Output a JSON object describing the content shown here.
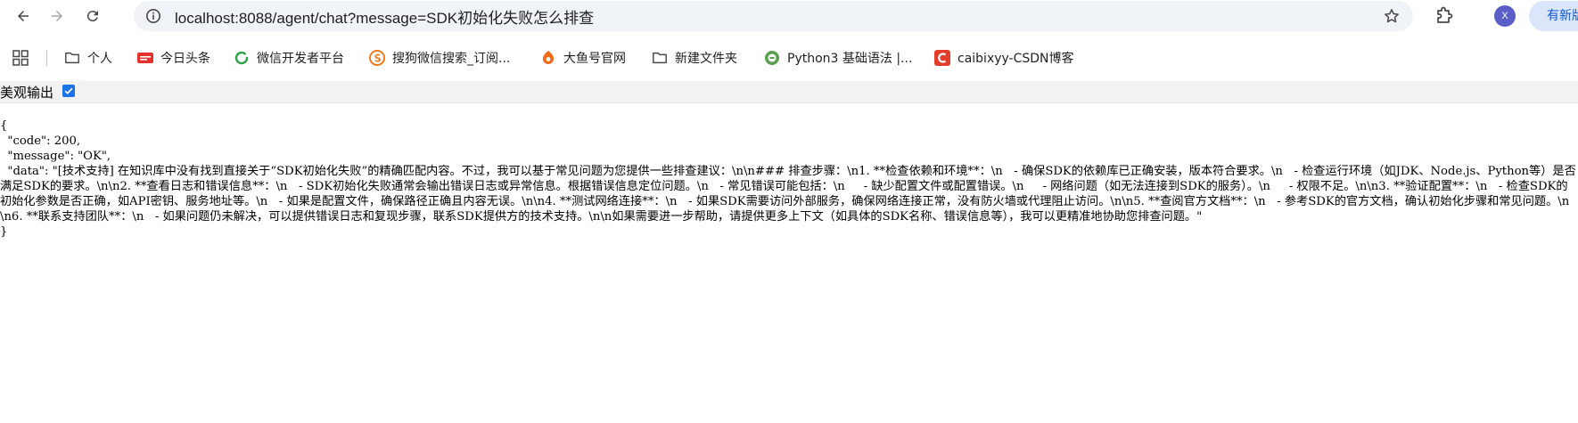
{
  "toolbar": {
    "url": "localhost:8088/agent/chat?message=SDK初始化失败怎么排查",
    "avatar_letter": "X",
    "update_label": "有新版"
  },
  "bookmarks": [
    {
      "label": "个人",
      "icon": "folder-icon"
    },
    {
      "label": "今日头条",
      "icon": "toutiao-icon"
    },
    {
      "label": "微信开发者平台",
      "icon": "wechat-dev-icon"
    },
    {
      "label": "搜狗微信搜索_订阅...",
      "icon": "sogou-icon"
    },
    {
      "label": "大鱼号官网",
      "icon": "dayu-icon"
    },
    {
      "label": "新建文件夹",
      "icon": "folder-icon"
    },
    {
      "label": "Python3 基础语法 |...",
      "icon": "python-icon"
    },
    {
      "label": "caibixyy-CSDN博客",
      "icon": "csdn-icon"
    }
  ],
  "viewer": {
    "pretty_label": "美观输出",
    "pretty_checked": true
  },
  "json": {
    "open": "{",
    "code_line": "  \"code\": 200,",
    "message_line": "  \"message\": \"OK\",",
    "data_line": "  \"data\": \"[技术支持] 在知识库中没有找到直接关于“SDK初始化失败”的精确匹配内容。不过，我可以基于常见问题为您提供一些排查建议：\\n\\n### 排查步骤：\\n1. **检查依赖和环境**：\\n   - 确保SDK的依赖库已正确安装，版本符合要求。\\n   - 检查运行环境（如JDK、Node.js、Python等）是否满足SDK的要求。\\n\\n2. **查看日志和错误信息**：\\n   - SDK初始化失败通常会输出错误日志或异常信息。根据错误信息定位问题。\\n   - 常见错误可能包括：\\n     - 缺少配置文件或配置错误。\\n     - 网络问题（如无法连接到SDK的服务）。\\n     - 权限不足。\\n\\n3. **验证配置**：\\n   - 检查SDK的初始化参数是否正确，如API密钥、服务地址等。\\n   - 如果是配置文件，确保路径正确且内容无误。\\n\\n4. **测试网络连接**：\\n   - 如果SDK需要访问外部服务，确保网络连接正常，没有防火墙或代理阻止访问。\\n\\n5. **查阅官方文档**：\\n   - 参考SDK的官方文档，确认初始化步骤和常见问题。\\n\\n6. **联系支持团队**：\\n   - 如果问题仍未解决，可以提供错误日志和复现步骤，联系SDK提供方的技术支持。\\n\\n如果需要进一步帮助，请提供更多上下文（如具体的SDK名称、错误信息等），我可以更精准地协助您排查问题。\"",
    "close": "}"
  }
}
